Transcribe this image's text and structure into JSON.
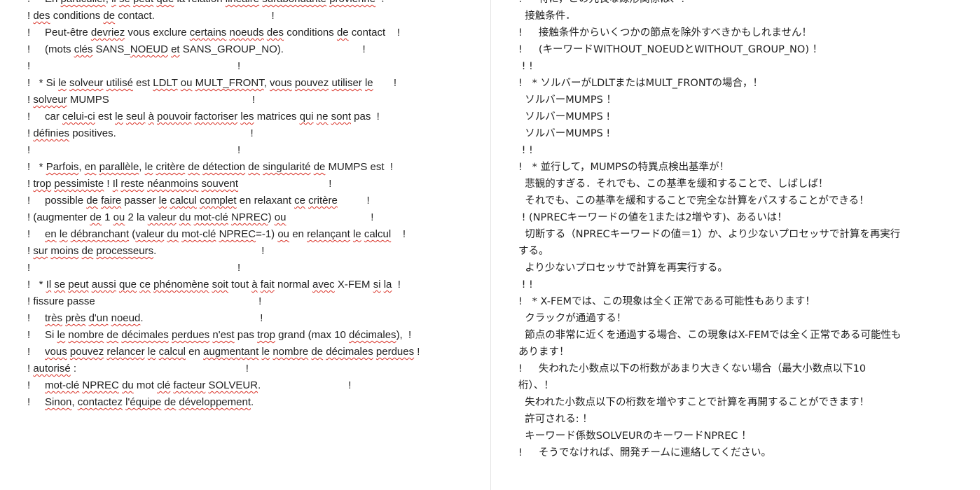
{
  "left_panel": {
    "lines": [
      [
        {
          "t": "!     "
        },
        {
          "t": "En"
        },
        {
          "t": " "
        },
        {
          "t": "particulier",
          "s": 1
        },
        {
          "t": ", "
        },
        {
          "t": "il",
          "s": 1
        },
        {
          "t": " "
        },
        {
          "t": "se",
          "s": 1
        },
        {
          "t": " "
        },
        {
          "t": "peut",
          "s": 1
        },
        {
          "t": " "
        },
        {
          "t": "que",
          "s": 1
        },
        {
          "t": " la relation "
        },
        {
          "t": "linéaire",
          "s": 1
        },
        {
          "t": " "
        },
        {
          "t": "surabondante",
          "s": 1
        },
        {
          "t": " "
        },
        {
          "t": "provienne",
          "s": 1
        },
        {
          "t": "  !"
        }
      ],
      [
        {
          "t": "! "
        },
        {
          "t": "des",
          "s": 1
        },
        {
          "t": " conditions "
        },
        {
          "t": "de",
          "s": 1
        },
        {
          "t": " contact.                                        !"
        }
      ],
      [
        {
          "t": "!     Peut-être "
        },
        {
          "t": "devriez",
          "s": 1
        },
        {
          "t": " vous exclure "
        },
        {
          "t": "certains",
          "s": 1
        },
        {
          "t": " "
        },
        {
          "t": "noeuds",
          "s": 1
        },
        {
          "t": " "
        },
        {
          "t": "des",
          "s": 1
        },
        {
          "t": " conditions "
        },
        {
          "t": "de",
          "s": 1
        },
        {
          "t": " contact    !"
        }
      ],
      [
        {
          "t": "!     (mots "
        },
        {
          "t": "clés",
          "s": 1
        },
        {
          "t": " SANS_"
        },
        {
          "t": "NOEUD",
          "s": 1
        },
        {
          "t": " "
        },
        {
          "t": "et",
          "s": 1
        },
        {
          "t": " SANS_GROUP_NO).                           !"
        }
      ],
      [
        {
          "t": "!                                                                       !"
        }
      ],
      [
        {
          "t": "!   * Si "
        },
        {
          "t": "le",
          "s": 1
        },
        {
          "t": " "
        },
        {
          "t": "solveur",
          "s": 1
        },
        {
          "t": " "
        },
        {
          "t": "utilisé",
          "s": 1
        },
        {
          "t": " est "
        },
        {
          "t": "LDLT",
          "s": 1
        },
        {
          "t": " "
        },
        {
          "t": "ou",
          "s": 1
        },
        {
          "t": " "
        },
        {
          "t": "MULT_FRONT",
          "s": 1
        },
        {
          "t": ", "
        },
        {
          "t": "vous",
          "s": 1
        },
        {
          "t": " "
        },
        {
          "t": "pouvez",
          "s": 1
        },
        {
          "t": " "
        },
        {
          "t": "utiliser",
          "s": 1
        },
        {
          "t": " "
        },
        {
          "t": "le",
          "s": 1
        },
        {
          "t": "       !"
        }
      ],
      [
        {
          "t": "! "
        },
        {
          "t": "solveur",
          "s": 1
        },
        {
          "t": " MUMPS                                                 !"
        }
      ],
      [
        {
          "t": "!     car "
        },
        {
          "t": "celui-ci",
          "s": 1
        },
        {
          "t": " est "
        },
        {
          "t": "le",
          "s": 1
        },
        {
          "t": " "
        },
        {
          "t": "seul",
          "s": 1
        },
        {
          "t": " "
        },
        {
          "t": "à",
          "s": 1
        },
        {
          "t": " "
        },
        {
          "t": "pouvoir",
          "s": 1
        },
        {
          "t": " "
        },
        {
          "t": "factoriser",
          "s": 1
        },
        {
          "t": " "
        },
        {
          "t": "les",
          "s": 1
        },
        {
          "t": " matrices "
        },
        {
          "t": "qui",
          "s": 1
        },
        {
          "t": " "
        },
        {
          "t": "ne",
          "s": 1
        },
        {
          "t": " "
        },
        {
          "t": "sont",
          "s": 1
        },
        {
          "t": " pas  !"
        }
      ],
      [
        {
          "t": "! "
        },
        {
          "t": "définies",
          "s": 1
        },
        {
          "t": " positives.                                              !"
        }
      ],
      [
        {
          "t": "!                                                                       !"
        }
      ],
      [
        {
          "t": "!   * "
        },
        {
          "t": "Parfois",
          "s": 1
        },
        {
          "t": ", "
        },
        {
          "t": "en",
          "s": 1
        },
        {
          "t": " "
        },
        {
          "t": "parallèle",
          "s": 1
        },
        {
          "t": ", "
        },
        {
          "t": "le",
          "s": 1
        },
        {
          "t": " "
        },
        {
          "t": "critère",
          "s": 1
        },
        {
          "t": " "
        },
        {
          "t": "de",
          "s": 1
        },
        {
          "t": " "
        },
        {
          "t": "détection",
          "s": 1
        },
        {
          "t": " "
        },
        {
          "t": "de",
          "s": 1
        },
        {
          "t": " "
        },
        {
          "t": "singularité",
          "s": 1
        },
        {
          "t": " "
        },
        {
          "t": "de",
          "s": 1
        },
        {
          "t": " MUMPS est  !"
        }
      ],
      [
        {
          "t": "! "
        },
        {
          "t": "trop",
          "s": 1
        },
        {
          "t": " "
        },
        {
          "t": "pessimiste",
          "s": 1
        },
        {
          "t": " ! "
        },
        {
          "t": "Il",
          "s": 1
        },
        {
          "t": " "
        },
        {
          "t": "reste",
          "s": 1
        },
        {
          "t": " "
        },
        {
          "t": "néanmoins",
          "s": 1
        },
        {
          "t": " "
        },
        {
          "t": "souvent",
          "s": 1
        },
        {
          "t": "                               !"
        }
      ],
      [
        {
          "t": "!     possible "
        },
        {
          "t": "de",
          "s": 1
        },
        {
          "t": " "
        },
        {
          "t": "faire",
          "s": 1
        },
        {
          "t": " passer "
        },
        {
          "t": "le",
          "s": 1
        },
        {
          "t": " "
        },
        {
          "t": "calcul",
          "s": 1
        },
        {
          "t": " "
        },
        {
          "t": "complet",
          "s": 1
        },
        {
          "t": " en relaxant "
        },
        {
          "t": "ce",
          "s": 1
        },
        {
          "t": " "
        },
        {
          "t": "critère",
          "s": 1
        },
        {
          "t": "          !"
        }
      ],
      [
        {
          "t": "! (augmenter "
        },
        {
          "t": "de",
          "s": 1
        },
        {
          "t": " 1 "
        },
        {
          "t": "ou",
          "s": 1
        },
        {
          "t": " 2 la "
        },
        {
          "t": "valeur",
          "s": 1
        },
        {
          "t": " "
        },
        {
          "t": "du",
          "s": 1
        },
        {
          "t": " "
        },
        {
          "t": "mot-clé",
          "s": 1
        },
        {
          "t": " "
        },
        {
          "t": "NPREC",
          "s": 1
        },
        {
          "t": ") "
        },
        {
          "t": "ou",
          "s": 1
        },
        {
          "t": "                             !"
        }
      ],
      [
        {
          "t": "!     "
        },
        {
          "t": "en",
          "s": 1
        },
        {
          "t": " "
        },
        {
          "t": "le",
          "s": 1
        },
        {
          "t": " "
        },
        {
          "t": "débranchant",
          "s": 1
        },
        {
          "t": " ("
        },
        {
          "t": "valeur",
          "s": 1
        },
        {
          "t": " "
        },
        {
          "t": "du",
          "s": 1
        },
        {
          "t": " "
        },
        {
          "t": "mot-clé",
          "s": 1
        },
        {
          "t": " "
        },
        {
          "t": "NPREC",
          "s": 1
        },
        {
          "t": "=-1) "
        },
        {
          "t": "ou",
          "s": 1
        },
        {
          "t": " en "
        },
        {
          "t": "relançant",
          "s": 1
        },
        {
          "t": " "
        },
        {
          "t": "le",
          "s": 1
        },
        {
          "t": " "
        },
        {
          "t": "calcul",
          "s": 1
        },
        {
          "t": "    !"
        }
      ],
      [
        {
          "t": "! "
        },
        {
          "t": "sur",
          "s": 1
        },
        {
          "t": " "
        },
        {
          "t": "moins",
          "s": 1
        },
        {
          "t": " "
        },
        {
          "t": "de",
          "s": 1
        },
        {
          "t": " "
        },
        {
          "t": "processeurs",
          "s": 1
        },
        {
          "t": ".                                    !"
        }
      ],
      [
        {
          "t": "!                                                                       !"
        }
      ],
      [
        {
          "t": "!   * "
        },
        {
          "t": "Il",
          "s": 1
        },
        {
          "t": " "
        },
        {
          "t": "se",
          "s": 1
        },
        {
          "t": " "
        },
        {
          "t": "peut",
          "s": 1
        },
        {
          "t": " "
        },
        {
          "t": "aussi",
          "s": 1
        },
        {
          "t": " "
        },
        {
          "t": "que",
          "s": 1
        },
        {
          "t": " "
        },
        {
          "t": "ce",
          "s": 1
        },
        {
          "t": " "
        },
        {
          "t": "phénomène",
          "s": 1
        },
        {
          "t": " "
        },
        {
          "t": "soit",
          "s": 1
        },
        {
          "t": " tout "
        },
        {
          "t": "à",
          "s": 1
        },
        {
          "t": " "
        },
        {
          "t": "fait",
          "s": 1
        },
        {
          "t": " normal "
        },
        {
          "t": "avec",
          "s": 1
        },
        {
          "t": " X-FEM "
        },
        {
          "t": "si",
          "s": 1
        },
        {
          "t": " "
        },
        {
          "t": "la",
          "s": 1
        },
        {
          "t": "  !"
        }
      ],
      [
        {
          "t": "! fissure passe                                                        !"
        }
      ],
      [
        {
          "t": "!     "
        },
        {
          "t": "très",
          "s": 1
        },
        {
          "t": " "
        },
        {
          "t": "près",
          "s": 1
        },
        {
          "t": " "
        },
        {
          "t": "d'un",
          "s": 1
        },
        {
          "t": " "
        },
        {
          "t": "noeud",
          "s": 1
        },
        {
          "t": ".                                        !"
        }
      ],
      [
        {
          "t": "!     Si "
        },
        {
          "t": "le",
          "s": 1
        },
        {
          "t": " "
        },
        {
          "t": "nombre",
          "s": 1
        },
        {
          "t": " "
        },
        {
          "t": "de",
          "s": 1
        },
        {
          "t": " "
        },
        {
          "t": "décimales",
          "s": 1
        },
        {
          "t": " "
        },
        {
          "t": "perdues",
          "s": 1
        },
        {
          "t": " "
        },
        {
          "t": "n'est",
          "s": 1
        },
        {
          "t": " pas "
        },
        {
          "t": "trop",
          "s": 1
        },
        {
          "t": " grand (max 10 "
        },
        {
          "t": "décimales",
          "s": 1
        },
        {
          "t": "),  !"
        }
      ],
      [
        {
          "t": "!     "
        },
        {
          "t": "vous",
          "s": 1
        },
        {
          "t": " "
        },
        {
          "t": "pouvez",
          "s": 1
        },
        {
          "t": " "
        },
        {
          "t": "relancer",
          "s": 1
        },
        {
          "t": " "
        },
        {
          "t": "le",
          "s": 1
        },
        {
          "t": " "
        },
        {
          "t": "calcul",
          "s": 1
        },
        {
          "t": " en "
        },
        {
          "t": "augmentant",
          "s": 1
        },
        {
          "t": " "
        },
        {
          "t": "le",
          "s": 1
        },
        {
          "t": " "
        },
        {
          "t": "nombre",
          "s": 1
        },
        {
          "t": " "
        },
        {
          "t": "de",
          "s": 1
        },
        {
          "t": " "
        },
        {
          "t": "décimales",
          "s": 1
        },
        {
          "t": " "
        },
        {
          "t": "perdues",
          "s": 1
        },
        {
          "t": " !"
        }
      ],
      [
        {
          "t": "! "
        },
        {
          "t": "autorisé",
          "s": 1
        },
        {
          "t": " :                                                          !"
        }
      ],
      [
        {
          "t": "!     "
        },
        {
          "t": "mot-clé",
          "s": 1
        },
        {
          "t": " "
        },
        {
          "t": "NPREC",
          "s": 1
        },
        {
          "t": " "
        },
        {
          "t": "du",
          "s": 1
        },
        {
          "t": " mot "
        },
        {
          "t": "clé",
          "s": 1
        },
        {
          "t": " "
        },
        {
          "t": "facteur",
          "s": 1
        },
        {
          "t": " "
        },
        {
          "t": "SOLVEUR",
          "s": 1
        },
        {
          "t": ".                              !"
        }
      ],
      [
        {
          "t": "!     "
        },
        {
          "t": "Sinon",
          "s": 1
        },
        {
          "t": ", "
        },
        {
          "t": "contactez",
          "s": 1
        },
        {
          "t": " "
        },
        {
          "t": "l'équipe",
          "s": 1
        },
        {
          "t": " "
        },
        {
          "t": "de",
          "s": 1
        },
        {
          "t": " "
        },
        {
          "t": "développement",
          "s": 1
        },
        {
          "t": "."
        }
      ]
    ]
  },
  "right_panel": {
    "lines": [
      [
        {
          "t": "!     特に，この冗長な線形関係は、！"
        }
      ],
      [
        {
          "t": "  接触条件．"
        }
      ],
      [
        {
          "t": "!     接触条件からいくつかの節点を除外すべきかもしれません！"
        }
      ],
      [
        {
          "t": "!     (キーワードWITHOUT_NOEUDとWITHOUT_GROUP_NO) ！"
        }
      ],
      [
        {
          "t": " ! !"
        }
      ],
      [
        {
          "t": "!   * ソルバーがLDLTまたはMULT_FRONTの場合，！"
        }
      ],
      [
        {
          "t": "  ソルバーMUMPS ！"
        }
      ],
      [
        {
          "t": "  ソルバーMUMPS !"
        }
      ],
      [
        {
          "t": "  ソルバーMUMPS !"
        }
      ],
      [
        {
          "t": " ! !"
        }
      ],
      [
        {
          "t": "!   * 並行して，MUMPSの特異点検出基準が！"
        }
      ],
      [
        {
          "t": "  悲観的すぎる．それでも、この基準を緩和することで、しばしば！"
        }
      ],
      [
        {
          "t": "  それでも、この基準を緩和することで完全な計算をパスすることができる！"
        }
      ],
      [
        {
          "t": " ! (NPRECキーワードの値を1または2増やす)、あるいは！"
        }
      ],
      [
        {
          "t": "  切断する（NPRECキーワードの値＝1）か、より少ないプロセッサで計算を再実行"
        }
      ],
      [
        {
          "t": "する。"
        }
      ],
      [
        {
          "t": "  より少ないプロセッサで計算を再実行する。"
        }
      ],
      [
        {
          "t": " ! !"
        }
      ],
      [
        {
          "t": "!   * X-FEMでは、この現象は全く正常である可能性もあります！"
        }
      ],
      [
        {
          "t": "  クラックが通過する！"
        }
      ],
      [
        {
          "t": "  節点の非常に近くを通過する場合、この現象はX-FEMでは全く正常である可能性も"
        }
      ],
      [
        {
          "t": "あります！"
        }
      ],
      [
        {
          "t": "!     失われた小数点以下の桁数があまり大きくない場合（最大小数点以下10"
        }
      ],
      [
        {
          "t": "桁）、！"
        }
      ],
      [
        {
          "t": "  失われた小数点以下の桁数を増やすことで計算を再開することができます！"
        }
      ],
      [
        {
          "t": "  許可される: ！"
        }
      ],
      [
        {
          "t": "  キーワード係数SOLVEURのキーワードNPREC ！"
        }
      ],
      [
        {
          "t": "!     そうでなければ、開発チームに連絡してください。"
        }
      ]
    ]
  }
}
